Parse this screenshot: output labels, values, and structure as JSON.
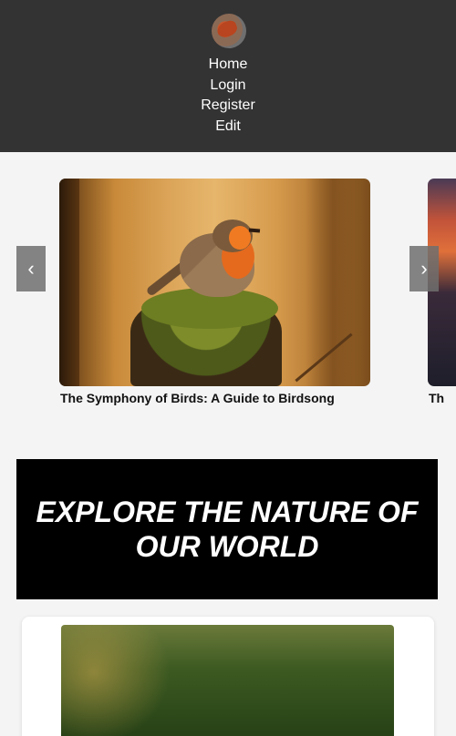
{
  "header": {
    "logo_alt": "site-logo",
    "nav": [
      "Home",
      "Login",
      "Register",
      "Edit"
    ]
  },
  "carousel": {
    "prev_label": "‹",
    "next_label": "›",
    "slides": [
      {
        "title": "The Symphony of Birds: A Guide to Birdsong"
      },
      {
        "title": "Th"
      }
    ]
  },
  "banner": {
    "text": "EXPLORE THE NATURE OF OUR WORLD"
  },
  "colors": {
    "header_bg": "#333333",
    "page_bg": "#f4f4f4",
    "banner_bg": "#000000"
  }
}
